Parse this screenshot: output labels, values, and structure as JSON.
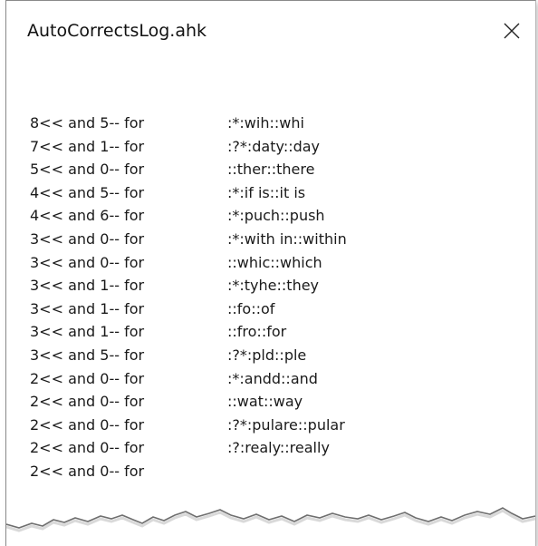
{
  "window": {
    "title": "AutoCorrectsLog.ahk",
    "close_icon": "close-icon"
  },
  "log": {
    "rows": [
      {
        "count": "8<< and 5-- for",
        "hotstring": ":*:wih::whi"
      },
      {
        "count": "7<< and 1-- for",
        "hotstring": ":?*:daty::day"
      },
      {
        "count": "5<< and 0-- for",
        "hotstring": "::ther::there"
      },
      {
        "count": "4<< and 5-- for",
        "hotstring": ":*:if is::it is"
      },
      {
        "count": "4<< and 6-- for",
        "hotstring": ":*:puch::push"
      },
      {
        "count": "3<< and 0-- for",
        "hotstring": ":*:with in::within"
      },
      {
        "count": "3<< and 0-- for",
        "hotstring": "::whic::which"
      },
      {
        "count": "3<< and 1-- for",
        "hotstring": ":*:tyhe::they"
      },
      {
        "count": "3<< and 1-- for",
        "hotstring": "::fo::of"
      },
      {
        "count": "3<< and 1-- for",
        "hotstring": "::fro::for"
      },
      {
        "count": "3<< and 5-- for",
        "hotstring": ":?*:pld::ple"
      },
      {
        "count": "2<< and 0-- for",
        "hotstring": ":*:andd::and"
      },
      {
        "count": "2<< and 0-- for",
        "hotstring": "::wat::way"
      },
      {
        "count": "2<< and 0-- for",
        "hotstring": ":?*:pulare::pular"
      },
      {
        "count": "2<< and 0-- for",
        "hotstring": ":?:realy::really"
      },
      {
        "count": "2<< and 0-- for",
        "hotstring": ""
      }
    ]
  }
}
